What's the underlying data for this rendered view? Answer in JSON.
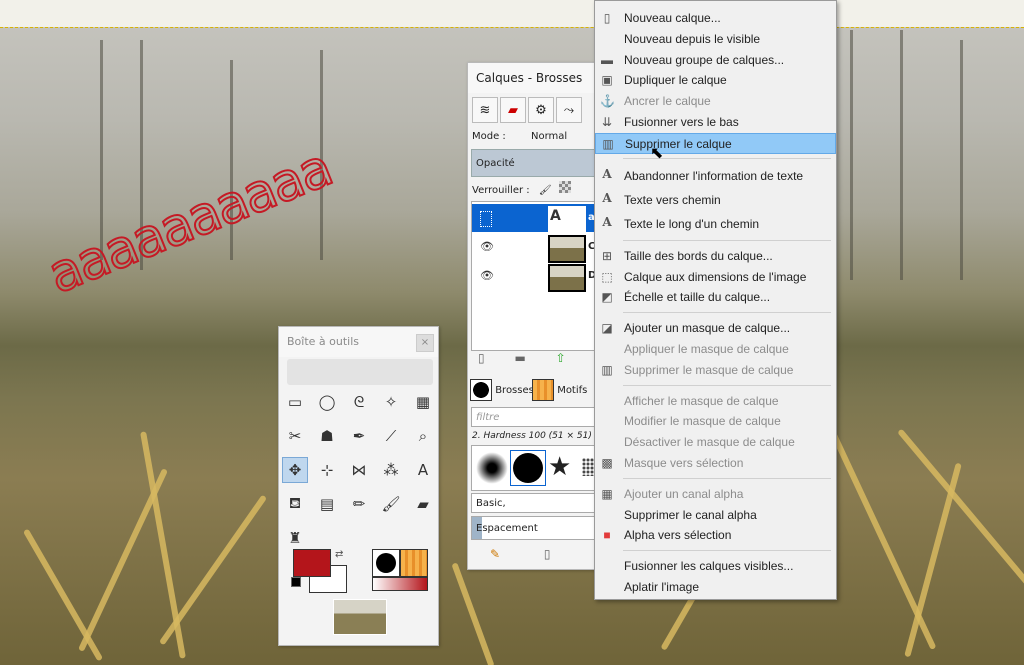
{
  "canvas": {
    "doodle_text": "aaaaaaaaaa"
  },
  "toolbox": {
    "title": "Boîte à outils",
    "close_icon": "×",
    "tools": [
      {
        "name": "rect-select-icon",
        "glyph": "▭"
      },
      {
        "name": "ellipse-select-icon",
        "glyph": "◯"
      },
      {
        "name": "lasso-icon",
        "glyph": "ᘓ"
      },
      {
        "name": "fuzzy-select-icon",
        "glyph": "✧"
      },
      {
        "name": "color-select-icon",
        "glyph": "▦"
      },
      {
        "name": "scissors-icon",
        "glyph": "✂"
      },
      {
        "name": "foreground-select-icon",
        "glyph": "☗"
      },
      {
        "name": "paths-icon",
        "glyph": "✒"
      },
      {
        "name": "color-picker-icon",
        "glyph": "⟋"
      },
      {
        "name": "zoom-icon",
        "glyph": "⌕"
      },
      {
        "name": "move-icon",
        "glyph": "✥"
      },
      {
        "name": "align-icon",
        "glyph": "⊹"
      },
      {
        "name": "crop-icon",
        "glyph": "⋈"
      },
      {
        "name": "transform-icon",
        "glyph": "⁂"
      },
      {
        "name": "text-tool-icon",
        "glyph": "A"
      },
      {
        "name": "bucket-fill-icon",
        "glyph": "⛾"
      },
      {
        "name": "gradient-icon",
        "glyph": "▤"
      },
      {
        "name": "pencil-icon",
        "glyph": "✏"
      },
      {
        "name": "paintbrush-icon",
        "glyph": "🖌"
      },
      {
        "name": "eraser-icon",
        "glyph": "▰"
      },
      {
        "name": "clone-icon",
        "glyph": "♜"
      }
    ]
  },
  "layers_dock": {
    "title": "Calques - Brosses",
    "mode_label": "Mode :",
    "mode_value": "Normal",
    "opacity_label": "Opacité",
    "lock_label": "Verrouiller :",
    "layers": [
      {
        "name": "a",
        "selected": true,
        "visible": false,
        "is_text": true
      },
      {
        "name": "C",
        "selected": false,
        "visible": true,
        "is_text": false
      },
      {
        "name": "D",
        "selected": false,
        "visible": true,
        "is_text": false
      }
    ],
    "brushes_tab": "Brosses",
    "patterns_tab": "Motifs",
    "filter_placeholder": "filtre",
    "brush_name": "2. Hardness 100 (51 × 51)",
    "brush_tag": "Basic,",
    "spacing_label": "Espacement"
  },
  "menu": {
    "items": [
      {
        "label": "Nouveau calque...",
        "icon": "new-layer-icon",
        "glyph": "▯",
        "disabled": false
      },
      {
        "label": "Nouveau depuis le visible",
        "icon": "",
        "glyph": "",
        "disabled": false
      },
      {
        "label": "Nouveau groupe de calques...",
        "icon": "folder-icon",
        "glyph": "▬",
        "disabled": false
      },
      {
        "label": "Dupliquer le calque",
        "icon": "duplicate-icon",
        "glyph": "▣",
        "disabled": false
      },
      {
        "label": "Ancrer le calque",
        "icon": "anchor-icon",
        "glyph": "⚓",
        "disabled": true
      },
      {
        "label": "Fusionner vers le bas",
        "icon": "merge-down-icon",
        "glyph": "⇊",
        "disabled": false
      },
      {
        "label": "Supprimer le calque",
        "icon": "trash-icon",
        "glyph": "▥",
        "disabled": false,
        "highlighted": true
      },
      {
        "sep": true
      },
      {
        "label": "Abandonner l'information de texte",
        "icon": "text-a-icon",
        "glyph": "A",
        "disabled": false,
        "bigA": true
      },
      {
        "label": "Texte vers chemin",
        "icon": "text-a-icon",
        "glyph": "A",
        "disabled": false,
        "bigA": true
      },
      {
        "label": "Texte le long d'un chemin",
        "icon": "text-a-icon",
        "glyph": "A",
        "disabled": false,
        "bigA": true
      },
      {
        "sep": true
      },
      {
        "label": "Taille des bords du calque...",
        "icon": "layer-boundary-icon",
        "glyph": "⊞",
        "disabled": false
      },
      {
        "label": "Calque aux dimensions de l'image",
        "icon": "layer-to-image-icon",
        "glyph": "⬚",
        "disabled": false
      },
      {
        "label": "Échelle et taille du calque...",
        "icon": "scale-layer-icon",
        "glyph": "◩",
        "disabled": false
      },
      {
        "sep": true
      },
      {
        "label": "Ajouter un masque de calque...",
        "icon": "add-mask-icon",
        "glyph": "◪",
        "disabled": false
      },
      {
        "label": "Appliquer le masque de calque",
        "icon": "",
        "glyph": "",
        "disabled": true
      },
      {
        "label": "Supprimer le masque de calque",
        "icon": "trash-icon",
        "glyph": "▥",
        "disabled": true
      },
      {
        "sep": true
      },
      {
        "label": "Afficher le masque de calque",
        "icon": "",
        "glyph": "",
        "disabled": true
      },
      {
        "label": "Modifier le masque de calque",
        "icon": "",
        "glyph": "",
        "disabled": true
      },
      {
        "label": "Désactiver le masque de calque",
        "icon": "",
        "glyph": "",
        "disabled": true
      },
      {
        "label": "Masque vers sélection",
        "icon": "mask-to-selection-icon",
        "glyph": "▩",
        "disabled": true
      },
      {
        "sep": true
      },
      {
        "label": "Ajouter un canal alpha",
        "icon": "alpha-icon",
        "glyph": "▦",
        "disabled": true
      },
      {
        "label": "Supprimer le canal alpha",
        "icon": "",
        "glyph": "",
        "disabled": false
      },
      {
        "label": "Alpha vers sélection",
        "icon": "alpha-to-selection-icon",
        "glyph": "■",
        "disabled": false,
        "red": true
      },
      {
        "sep": true
      },
      {
        "label": "Fusionner les calques visibles...",
        "icon": "",
        "glyph": "",
        "disabled": false
      },
      {
        "label": "Aplatir l'image",
        "icon": "",
        "glyph": "",
        "disabled": false
      }
    ]
  },
  "colors": {
    "foreground": "#b4151b",
    "background": "#ffffff",
    "selection": "#0b64d0",
    "menu_highlight": "#91c9f7"
  }
}
